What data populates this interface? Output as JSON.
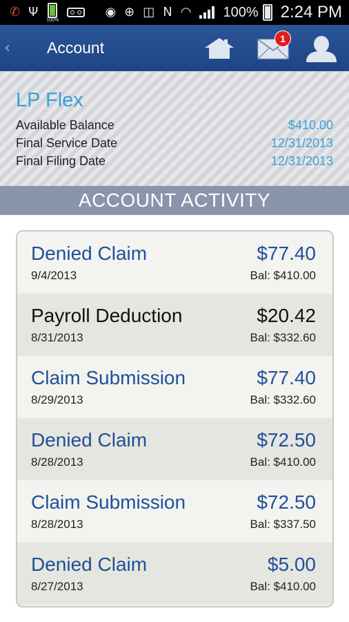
{
  "status_bar": {
    "battery_small_label": "100%",
    "battery_percent": "100%",
    "time": "2:24 PM"
  },
  "header": {
    "title": "Account",
    "mail_badge": "1"
  },
  "account": {
    "plan_name": "LP Flex",
    "rows": [
      {
        "label": "Available Balance",
        "value": "$410.00"
      },
      {
        "label": "Final Service Date",
        "value": "12/31/2013"
      },
      {
        "label": "Final Filing Date",
        "value": "12/31/2013"
      }
    ]
  },
  "activity": {
    "heading": "ACCOUNT ACTIVITY",
    "items": [
      {
        "type": "Denied Claim",
        "amount": "$77.40",
        "date": "9/4/2013",
        "balance": "Bal: $410.00",
        "color": "#1f4f99"
      },
      {
        "type": "Payroll Deduction",
        "amount": "$20.42",
        "date": "8/31/2013",
        "balance": "Bal: $332.60",
        "color": "#111111"
      },
      {
        "type": "Claim Submission",
        "amount": "$77.40",
        "date": "8/29/2013",
        "balance": "Bal: $332.60",
        "color": "#1f4f99"
      },
      {
        "type": "Denied Claim",
        "amount": "$72.50",
        "date": "8/28/2013",
        "balance": "Bal: $410.00",
        "color": "#1f4f99"
      },
      {
        "type": "Claim Submission",
        "amount": "$72.50",
        "date": "8/28/2013",
        "balance": "Bal: $337.50",
        "color": "#1f4f99"
      },
      {
        "type": "Denied Claim",
        "amount": "$5.00",
        "date": "8/27/2013",
        "balance": "Bal: $410.00",
        "color": "#1f4f99"
      }
    ]
  },
  "icons": {
    "status_left": [
      "missed-call-icon",
      "usb-icon",
      "battery-icon",
      "voicemail-icon"
    ],
    "status_right": [
      "eye-icon",
      "nfc-icon",
      "vibrate-icon",
      "no-signal-icon",
      "wifi-icon",
      "signal-bars-icon",
      "battery-icon"
    ],
    "header": [
      "chevron-left-icon",
      "home-icon",
      "mail-icon",
      "user-icon"
    ]
  },
  "colors": {
    "header_bg": "#2a5598",
    "accent_blue": "#3ba1d6",
    "item_blue": "#1f4f99",
    "banner_bg": "#8a95ab",
    "badge_red": "#e21c1c"
  }
}
